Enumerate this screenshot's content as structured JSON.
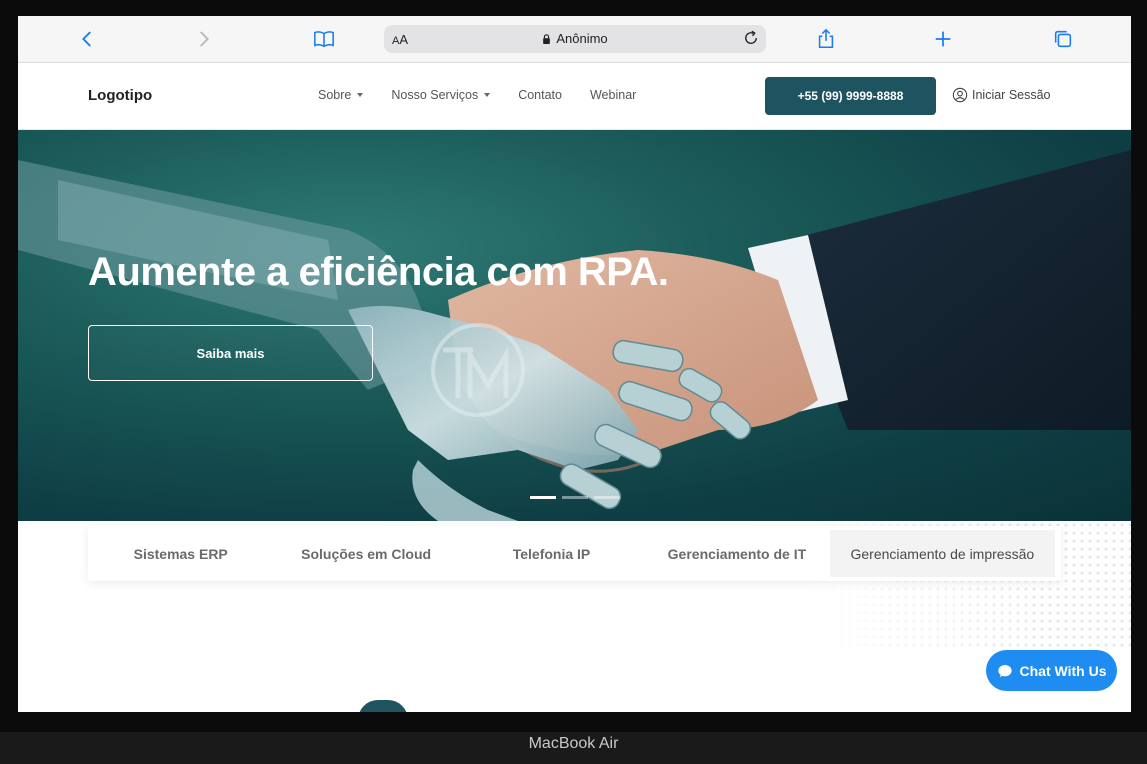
{
  "browser": {
    "text_size_label": "AA",
    "address_text": "Anônimo",
    "icons": [
      "back-icon",
      "forward-icon",
      "bookmarks-icon",
      "lock-icon",
      "reload-icon",
      "share-icon",
      "new-tab-icon",
      "tabs-icon"
    ]
  },
  "nav": {
    "logo": "Logotipo",
    "menu": [
      {
        "label": "Sobre",
        "dropdown": true
      },
      {
        "label": "Nosso Serviços",
        "dropdown": true
      },
      {
        "label": "Contato",
        "dropdown": false
      },
      {
        "label": "Webinar",
        "dropdown": false
      }
    ],
    "phone": "+55 (99) 9999-8888",
    "login": "Iniciar Sessão"
  },
  "hero": {
    "title": "Aumente a eficiência com RPA.",
    "button": "Saiba mais",
    "slides": 3,
    "active_slide": 1
  },
  "services": {
    "tabs": [
      "Sistemas ERP",
      "Soluções em Cloud",
      "Telefonia IP",
      "Gerenciamento de IT",
      "Gerenciamento de impressão"
    ],
    "active_tab": 4
  },
  "chat": {
    "label": "Chat With Us"
  },
  "device": {
    "label": "MacBook Air"
  },
  "colors": {
    "primary": "#1e5360",
    "chat": "#1e8cf0",
    "safari_blue": "#1a7cf2"
  }
}
